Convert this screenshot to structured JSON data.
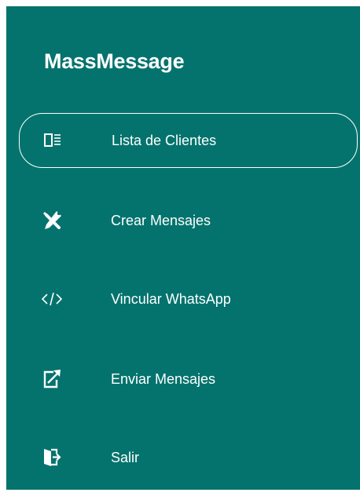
{
  "app": {
    "title": "MassMessage"
  },
  "sidebar": {
    "items": [
      {
        "label": "Lista de Clientes",
        "icon": "list-icon",
        "active": true
      },
      {
        "label": "Crear Mensajes",
        "icon": "tools-icon",
        "active": false
      },
      {
        "label": "Vincular WhatsApp",
        "icon": "code-icon",
        "active": false
      },
      {
        "label": "Enviar Mensajes",
        "icon": "send-edit-icon",
        "active": false
      },
      {
        "label": "Salir",
        "icon": "logout-icon",
        "active": false
      }
    ]
  },
  "colors": {
    "sidebar_bg": "#04736d",
    "text": "#ffffff"
  }
}
